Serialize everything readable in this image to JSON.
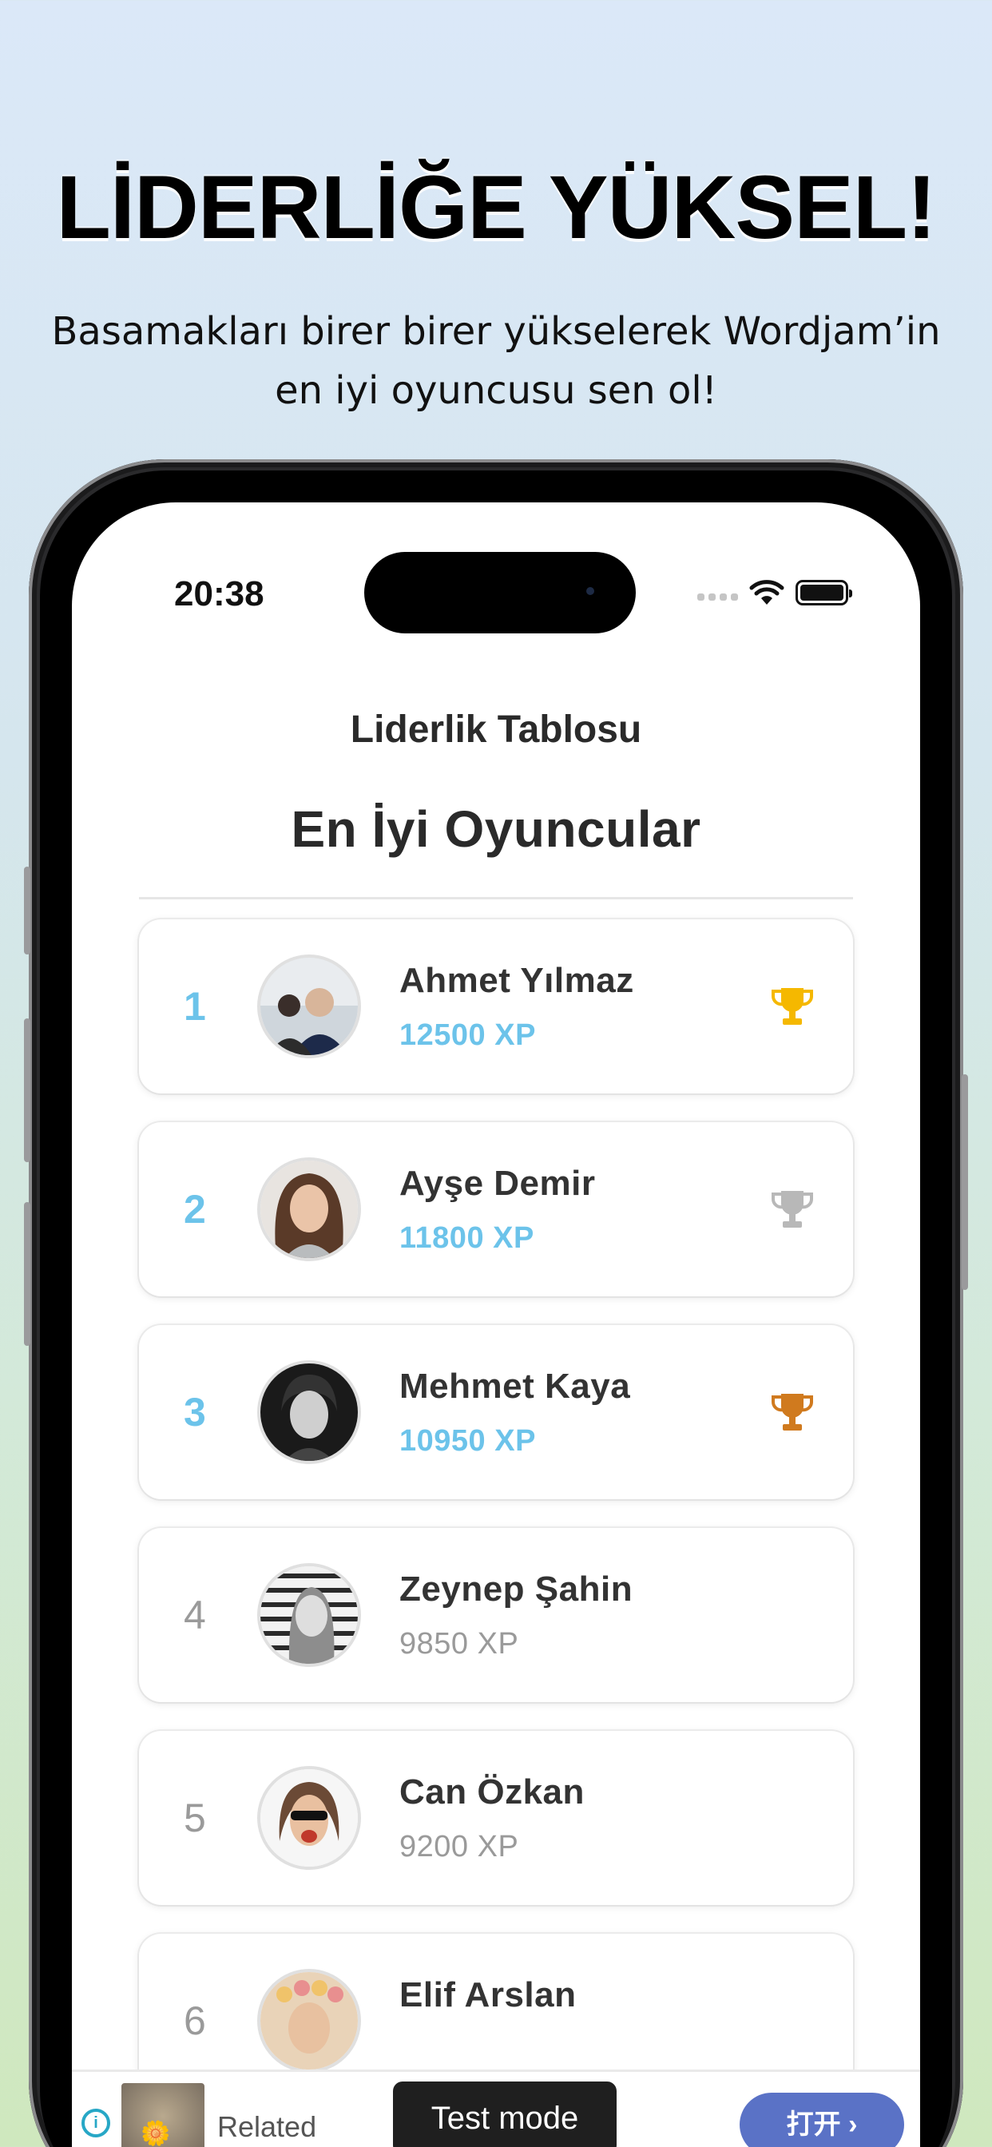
{
  "promo": {
    "headline": "LİDERLİĞE YÜKSEL!",
    "subtitle": "Basamakları birer birer yükselerek Wordjam’in en iyi oyuncusu sen ol!"
  },
  "status_bar": {
    "time": "20:38"
  },
  "app": {
    "title": "Liderlik Tablosu",
    "section_title": "En İyi Oyuncular"
  },
  "players": [
    {
      "rank": "1",
      "name": "Ahmet Yılmaz",
      "xp": "12500 XP",
      "trophy": "gold-trophy-icon"
    },
    {
      "rank": "2",
      "name": "Ayşe Demir",
      "xp": "11800 XP",
      "trophy": "silver-trophy-icon"
    },
    {
      "rank": "3",
      "name": "Mehmet Kaya",
      "xp": "10950 XP",
      "trophy": "bronze-trophy-icon"
    },
    {
      "rank": "4",
      "name": "Zeynep Şahin",
      "xp": "9850 XP"
    },
    {
      "rank": "5",
      "name": "Can Özkan",
      "xp": "9200 XP"
    },
    {
      "rank": "6",
      "name": "Elif Arslan"
    }
  ],
  "ad": {
    "related_label": "Related",
    "test_mode_label": "Test mode",
    "open_label": "打开"
  },
  "colors": {
    "top_rank": "#6cc3ea",
    "other_rank": "#9a9a9a",
    "gold": "#f5b800",
    "silver": "#b8b8b8",
    "bronze": "#d07a1e",
    "ad_button": "#5a72c6"
  }
}
